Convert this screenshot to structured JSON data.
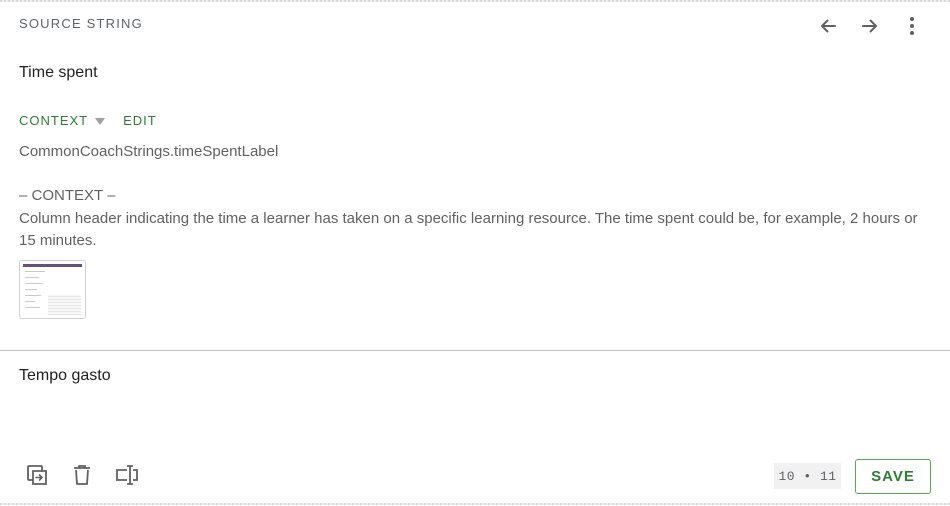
{
  "source": {
    "label": "SOURCE STRING",
    "text": "Time spent",
    "context_toggle_label": "CONTEXT",
    "edit_label": "EDIT",
    "string_key": "CommonCoachStrings.timeSpentLabel",
    "context_heading": "– CONTEXT –",
    "context_description": "Column header indicating the time a learner has taken on a specific learning resource. The time spent could be, for example, 2 hours or 15 minutes."
  },
  "nav": {
    "icons": [
      "arrow-left-icon",
      "arrow-right-icon",
      "more-vert-icon"
    ]
  },
  "translation": {
    "text": "Tempo gasto"
  },
  "toolbar": {
    "icons": [
      "copy-source-icon",
      "delete-icon",
      "text-cursor-icon"
    ],
    "counter": "10 • 11",
    "save_label": "SAVE"
  },
  "colors": {
    "accent": "#2e7d32",
    "save_border": "#4caf50",
    "muted_text": "#616161"
  }
}
